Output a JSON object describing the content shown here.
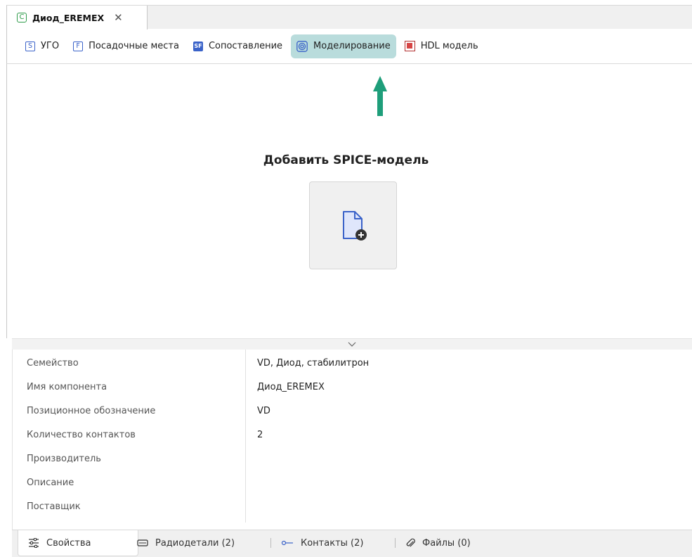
{
  "document_tab": {
    "icon_letter": "C",
    "title": "Диод_EREMEX"
  },
  "subtabs": [
    {
      "icon": "S",
      "label": "УГО"
    },
    {
      "icon": "F",
      "label": "Посадочные места"
    },
    {
      "icon": "SF",
      "label": "Сопоставление"
    },
    {
      "icon": "simulation-icon",
      "label": "Моделирование",
      "active": true
    },
    {
      "icon": "hdl-icon",
      "label": "HDL модель"
    }
  ],
  "main": {
    "add_title": "Добавить SPICE-модель",
    "add_button_icon": "file-add-icon"
  },
  "properties": [
    {
      "key": "Семейство",
      "value": "VD, Диод, стабилитрон"
    },
    {
      "key": "Имя компонента",
      "value": "Диод_EREMEX"
    },
    {
      "key": "Позиционное обозначение",
      "value": "VD"
    },
    {
      "key": "Количество контактов",
      "value": "2"
    },
    {
      "key": "Производитель",
      "value": ""
    },
    {
      "key": "Описание",
      "value": ""
    },
    {
      "key": "Поставщик",
      "value": ""
    }
  ],
  "bottom_tabs": [
    {
      "label": "Свойства",
      "icon": "settings-sliders-icon",
      "active": true
    },
    {
      "label": "Радиодетали (2)",
      "icon": "chip-icon"
    },
    {
      "label": "Контакты (2)",
      "icon": "pin-icon"
    },
    {
      "label": "Файлы (0)",
      "icon": "paperclip-icon"
    }
  ],
  "colors": {
    "active_tab": "#b9dcdc",
    "arrow": "#1e9e7a",
    "accent_blue": "#3b63c9"
  }
}
